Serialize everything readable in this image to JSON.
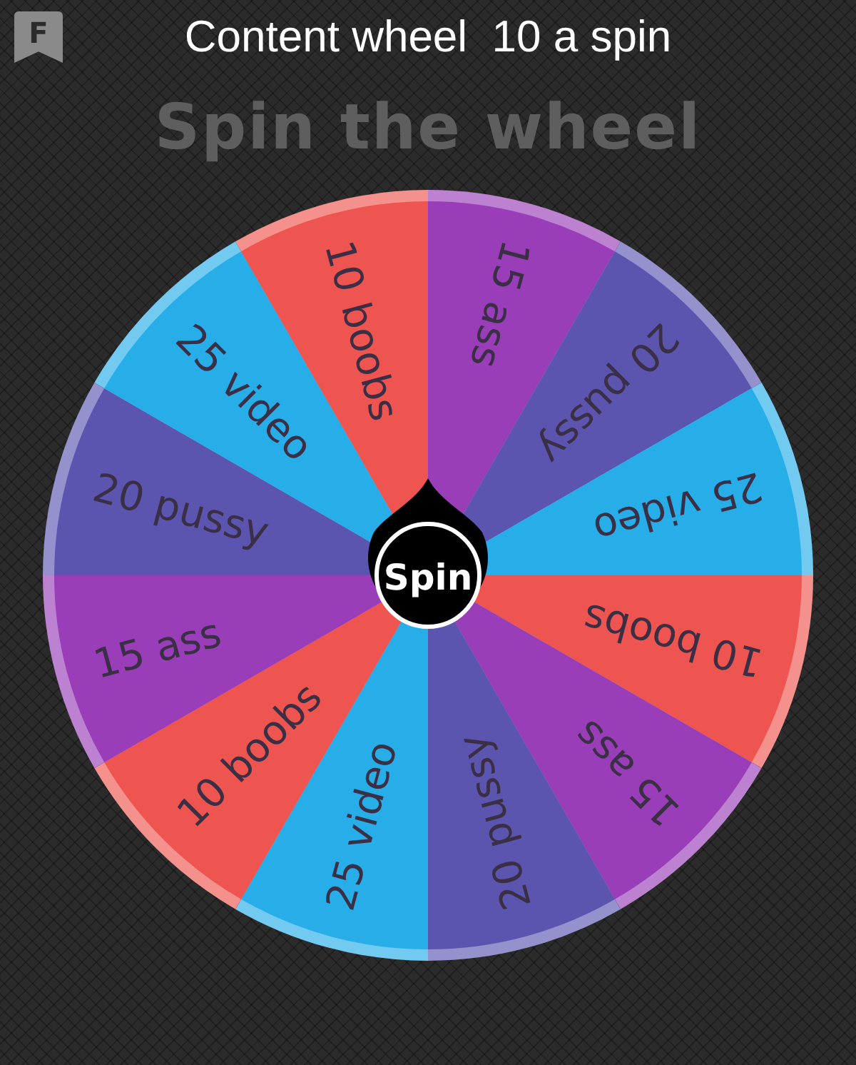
{
  "header": {
    "badge": "F",
    "title": "Content wheel  10 a spin"
  },
  "heading": "Spin the wheel",
  "wheel": {
    "segments": [
      {
        "label": "15 ass",
        "color": "#9a3db8"
      },
      {
        "label": "20 pussy",
        "color": "#5b55b0"
      },
      {
        "label": "25 video",
        "color": "#27ade8"
      },
      {
        "label": "10 boobs",
        "color": "#ef5550"
      },
      {
        "label": "15 ass",
        "color": "#9a3db8"
      },
      {
        "label": "20 pussy",
        "color": "#5b55b0"
      },
      {
        "label": "25 video",
        "color": "#27ade8"
      },
      {
        "label": "10 boobs",
        "color": "#ef5550"
      },
      {
        "label": "15 ass",
        "color": "#9a3db8"
      },
      {
        "label": "20 pussy",
        "color": "#5b55b0"
      },
      {
        "label": "25 video",
        "color": "#27ade8"
      },
      {
        "label": "10 boobs",
        "color": "#ef5550"
      }
    ],
    "button": "Spin"
  }
}
